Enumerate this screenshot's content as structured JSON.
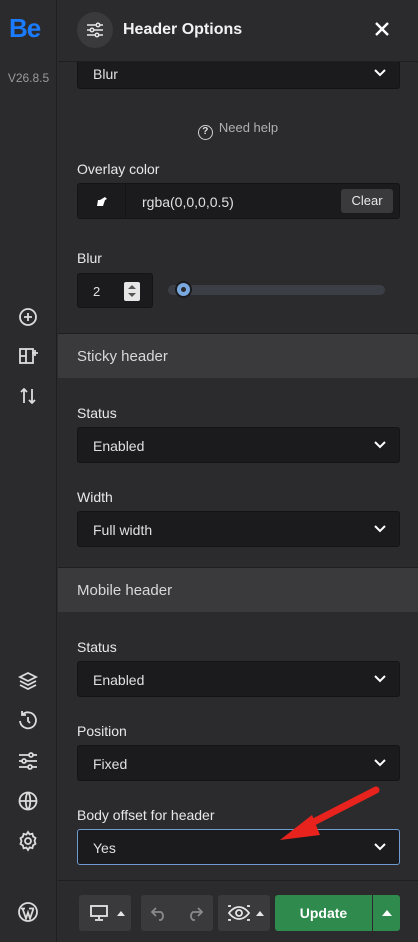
{
  "brand": {
    "logo": "Be",
    "version": "V26.8.5"
  },
  "rail_icons": [
    "add-circle-icon",
    "layout-add-icon",
    "sort-arrows-icon",
    "layers-icon",
    "history-icon",
    "sliders-icon",
    "globe-icon",
    "settings-icon",
    "wordpress-icon"
  ],
  "panel": {
    "title": "Header Options",
    "top_select": {
      "value": "Blur"
    },
    "need_help": "Need help",
    "overlay_color": {
      "label": "Overlay color",
      "value": "rgba(0,0,0,0.5)",
      "clear_label": "Clear"
    },
    "blur": {
      "label": "Blur",
      "value": "2",
      "slider_fraction": 0.07
    },
    "sticky_header": {
      "title": "Sticky header",
      "status": {
        "label": "Status",
        "value": "Enabled"
      },
      "width": {
        "label": "Width",
        "value": "Full width"
      }
    },
    "mobile_header": {
      "title": "Mobile header",
      "status": {
        "label": "Status",
        "value": "Enabled"
      },
      "position": {
        "label": "Position",
        "value": "Fixed"
      },
      "body_offset": {
        "label": "Body offset for header",
        "value": "Yes"
      }
    }
  },
  "bottom_bar": {
    "update_label": "Update"
  },
  "colors": {
    "accent": "#2f8a4e",
    "logo": "#1a7bff",
    "annotation_arrow": "#e8231e",
    "slider": "#7aa9e0"
  }
}
